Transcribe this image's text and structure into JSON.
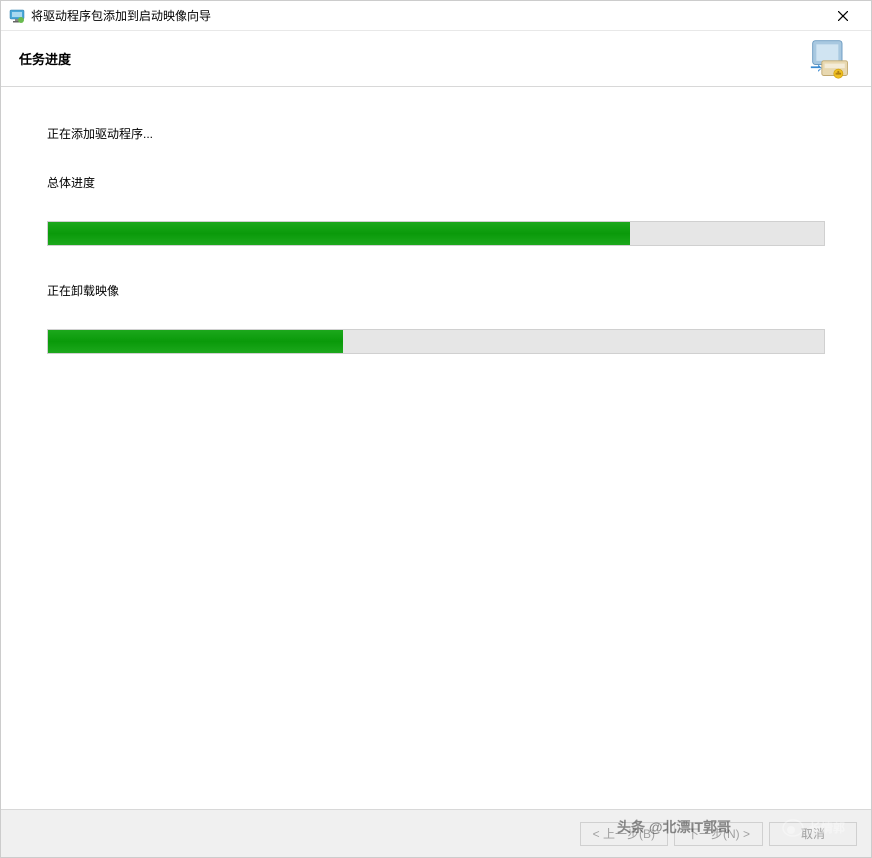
{
  "window": {
    "title": "将驱动程序包添加到启动映像向导"
  },
  "header": {
    "title": "任务进度"
  },
  "content": {
    "status_text": "正在添加驱动程序...",
    "overall_label": "总体进度",
    "overall_progress_percent": 75,
    "current_label": "正在卸载映像",
    "current_progress_percent": 38
  },
  "footer": {
    "back_label": "< 上一步(B)",
    "next_label": "下一步(N) >",
    "cancel_label": "取消"
  },
  "watermark": {
    "text1": "头条 @北漂IT郭哥",
    "text2": "长情郭"
  }
}
